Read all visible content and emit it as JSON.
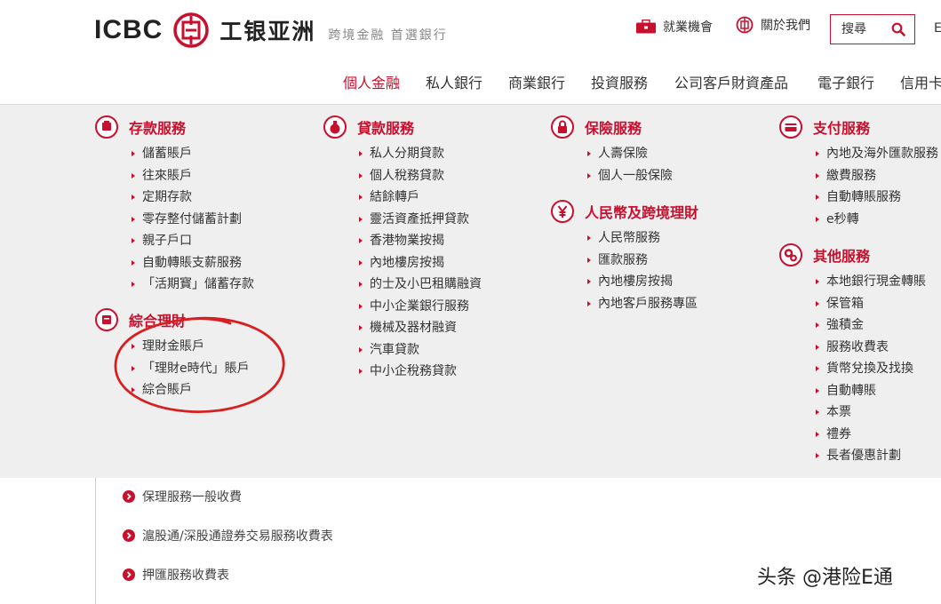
{
  "header": {
    "logo_text": "ICBC",
    "logo_cn": "工银亚洲",
    "tagline": "跨境金融 首選銀行",
    "careers_label": "就業機會",
    "about_label": "關於我們",
    "search_placeholder": "搜尋",
    "lang_label": "E"
  },
  "nav": {
    "items": [
      {
        "label": "個人金融",
        "active": true
      },
      {
        "label": "私人銀行"
      },
      {
        "label": "商業銀行"
      },
      {
        "label": "投資服務"
      },
      {
        "label": "公司客戶財資產品"
      },
      {
        "label": "電子銀行"
      },
      {
        "label": "信用卡"
      }
    ]
  },
  "menu": {
    "deposit": {
      "title": "存款服務",
      "items": [
        "儲蓄賬戶",
        "往來賬戶",
        "定期存款",
        "零存整付儲蓄計劃",
        "親子戶口",
        "自動轉賬支薪服務",
        "「活期寳」儲蓄存款"
      ]
    },
    "wealth": {
      "title": "綜合理財",
      "items": [
        "理財金賬戶",
        "「理財e時代」賬戶",
        "綜合賬戶"
      ]
    },
    "loan": {
      "title": "貸款服務",
      "items": [
        "私人分期貸款",
        "個人稅務貸款",
        "結餘轉戶",
        "靈活資產抵押貸款",
        "香港物業按揭",
        "內地樓房按揭",
        "的士及小巴租購融資",
        "中小企業銀行服務",
        "機械及器材融資",
        "汽車貸款",
        "中小企稅務貸款"
      ]
    },
    "insurance": {
      "title": "保險服務",
      "items": [
        "人壽保險",
        "個人一般保險"
      ]
    },
    "rmb": {
      "title": "人民幣及跨境理財",
      "items": [
        "人民幣服務",
        "匯款服務",
        "內地樓房按揭",
        "內地客戶服務專區"
      ]
    },
    "payment": {
      "title": "支付服務",
      "items": [
        "內地及海外匯款服務",
        "繳費服務",
        "自動轉賬服務",
        "e秒轉"
      ]
    },
    "other": {
      "title": "其他服務",
      "items": [
        "本地銀行現金轉賬",
        "保管箱",
        "強積金",
        "服務收費表",
        "貨幣兌換及找換",
        "自動轉賬",
        "本票",
        "禮券",
        "長者優惠計劃"
      ]
    }
  },
  "fees": {
    "items": [
      "保理服務一般收費",
      "滬股通/深股通證券交易服務收費表",
      "押匯服務收費表"
    ]
  },
  "watermark": "头条 @港险E通",
  "colors": {
    "accent": "#c8102e",
    "menu_bg": "#efefef",
    "annotation_circle": "#d81e1e"
  }
}
